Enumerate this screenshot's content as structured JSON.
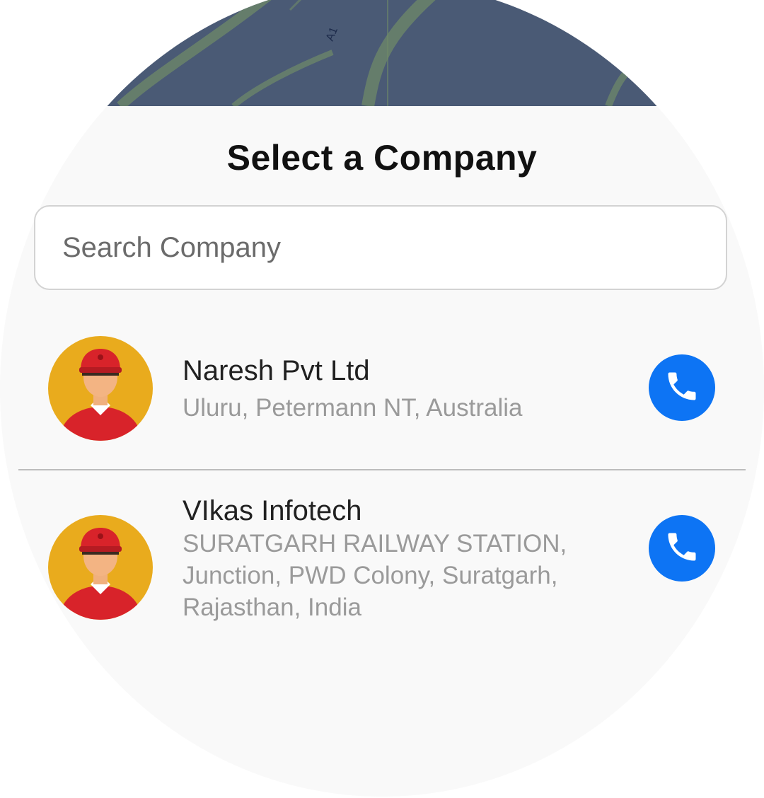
{
  "sheet": {
    "title": "Select a Company",
    "search": {
      "placeholder": "Search Company",
      "value": ""
    }
  },
  "map": {
    "road_label": "A1",
    "background_color": "#4a5a75"
  },
  "companies": [
    {
      "name": "Naresh Pvt Ltd",
      "address": "Uluru, Petermann NT, Australia",
      "avatar_icon": "delivery-person-avatar-icon",
      "action_icon": "phone-icon"
    },
    {
      "name": "VIkas Infotech",
      "address": "SURATGARH RAILWAY STATION, Junction, PWD Colony, Suratgarh, Rajasthan, India",
      "avatar_icon": "delivery-person-avatar-icon",
      "action_icon": "phone-icon"
    }
  ],
  "colors": {
    "accent": "#0d74f4",
    "avatar_background": "#e9ab1d",
    "sheet_background": "#f9f9f9",
    "title_text": "#111111",
    "secondary_text": "#9a9a9a"
  }
}
